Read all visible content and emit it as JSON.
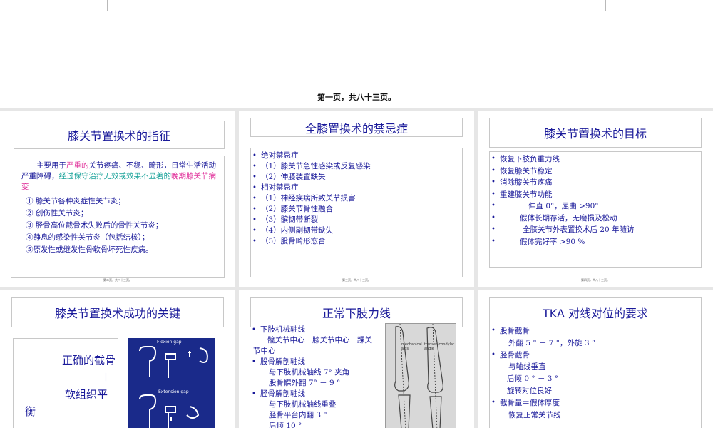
{
  "page_caption": "第一页，共八十三页。",
  "slides": {
    "s1": {
      "title": "膝关节置换术的指征",
      "intro_a": "主要用于",
      "intro_b": "严重的",
      "intro_c": "关节疼痛、不稳、畸形，日常生活活动严重障碍，",
      "intro_d": "经过保守治疗无效或效果不显著的",
      "intro_e": "晚期膝关节病变",
      "items": [
        "① 膝关节各种炎症性关节炎；",
        "② 创伤性关节炎；",
        "③ 胫骨高位截骨术失败后的骨性关节炎；",
        "④静息的感染性关节炎（包括结核）；",
        "⑤原发性或继发性骨软骨坏死性疾病。"
      ],
      "footer": "第二页，共八十三页。"
    },
    "s2": {
      "title": "全膝置换术的禁忌症",
      "items": [
        "绝对禁忌症",
        "（1）膝关节急性感染或反复感染",
        "（2）伸膝装置缺失",
        "相对禁忌症",
        "（1）神经疾病所致关节损害",
        "（2）膝关节骨性融合",
        "（3）髌韧带断裂",
        "（4）内侧副韧带缺失",
        "（5）股骨畸形愈合"
      ],
      "footer": "第三页，共八十三页。"
    },
    "s3": {
      "title": "膝关节置换术的目标",
      "items": [
        "恢复下肢负重力线",
        "恢复膝关节稳定",
        "消除膝关节疼痛",
        "重建膝关节功能",
        "伸直 0°，屈曲 >90°",
        "假体长期存活，无磨损及松动",
        "全膝关节外表置换术后 20 年随访",
        "假体完好率 >90 %"
      ],
      "footer": "第四页，共八十三页。"
    },
    "s4": {
      "title": "膝关节置换术成功的关键",
      "line1": "正确的截骨",
      "line2": "＋",
      "line3": "软组织平",
      "line4": "衡",
      "fig_top": "Flexion gap",
      "fig_mid": "Extension gap"
    },
    "s5": {
      "title": "正常下肢力线",
      "items": [
        "下肢机械轴线",
        "髋关节中心－膝关节中心－踝关",
        "节中心",
        "股骨解剖轴线",
        "与下肢机械轴线 7° 夹角",
        "股骨髁外翻 7° － 9 °",
        "胫骨解剖轴线",
        "与下肢机械轴线重叠",
        "胫骨平台内翻 3 °",
        "后倾 10 °"
      ],
      "fig_label_a": "mechanical axis",
      "fig_label_b": "transepicondylar angle"
    },
    "s6": {
      "title": "TKA 对线对位的要求",
      "items": [
        "股骨截骨",
        "外翻   5 ° － 7 °，外旋 3 °",
        "胫骨截骨",
        "与轴线垂直",
        "后倾 0 ° － 3 °",
        "旋转对位良好",
        "截骨量＝假体厚度",
        "恢复正常关节线"
      ]
    }
  }
}
